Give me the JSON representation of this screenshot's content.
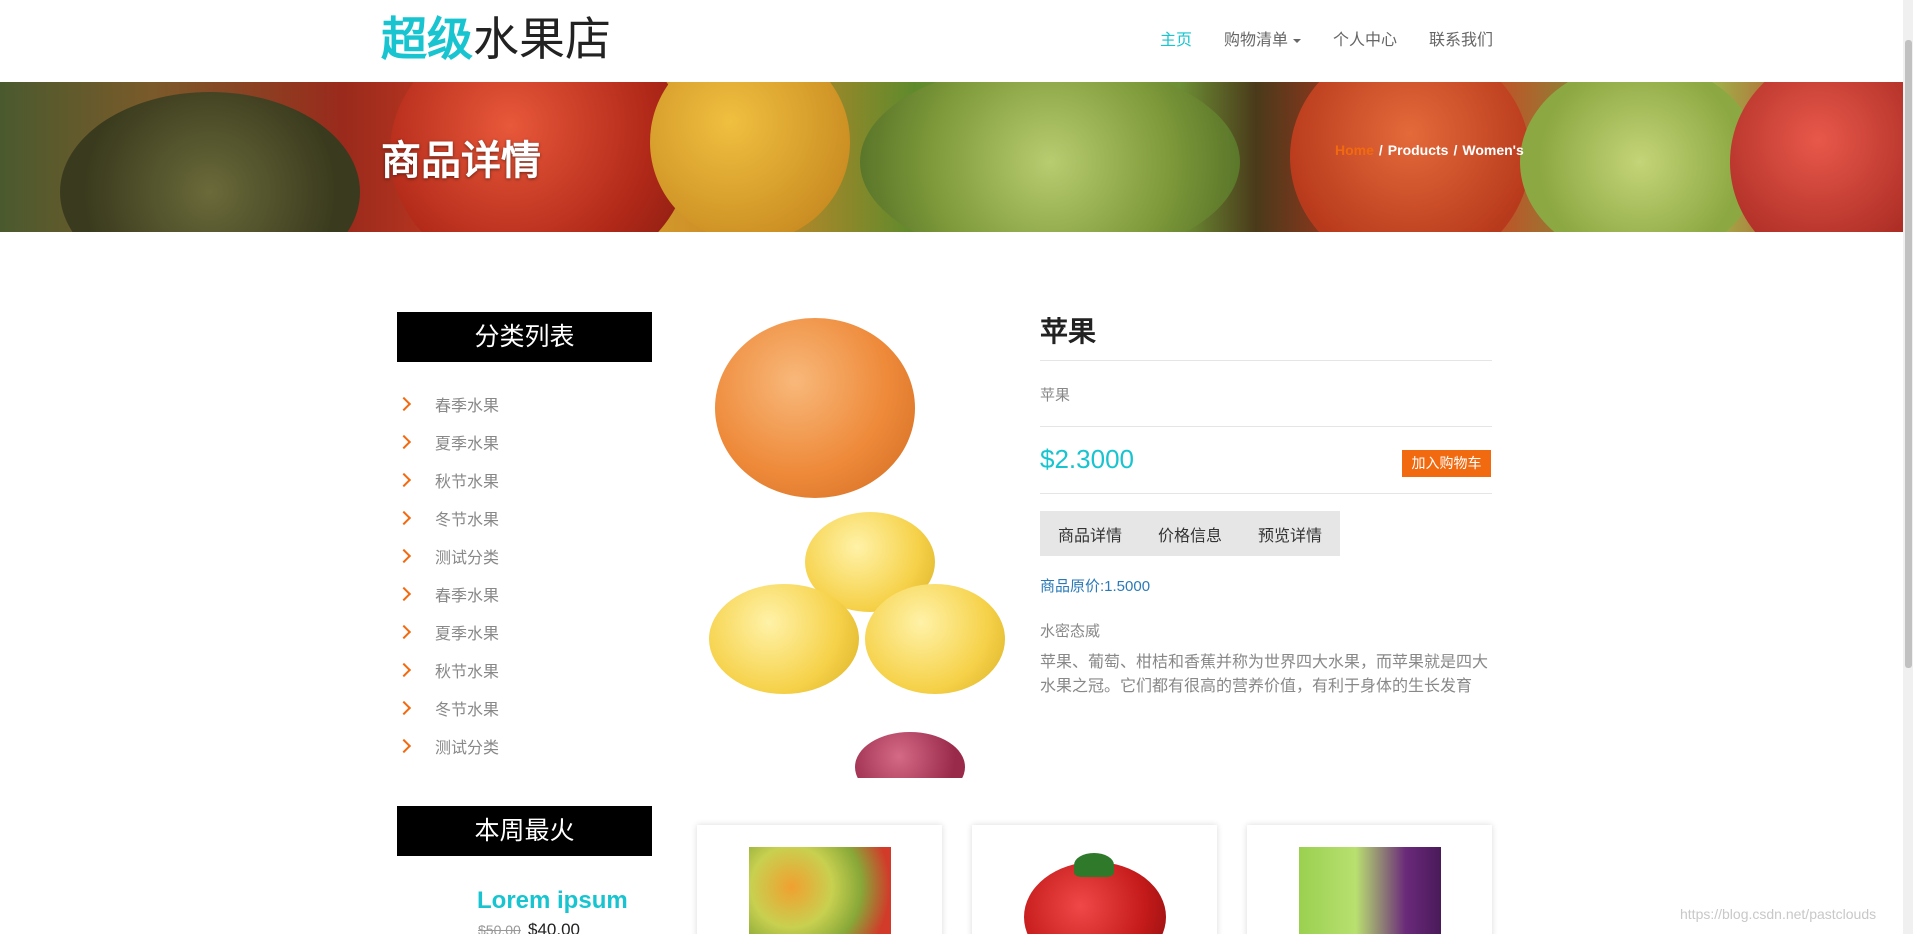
{
  "header": {
    "logo_part1": "超级",
    "logo_part2": "水果店",
    "nav": {
      "home": "主页",
      "shopping_list": "购物清单",
      "personal_center": "个人中心",
      "contact_us": "联系我们"
    }
  },
  "banner": {
    "title": "商品详情",
    "breadcrumb": [
      "Home",
      "Products",
      "Women's"
    ]
  },
  "sidebar": {
    "category_heading": "分类列表",
    "categories": [
      "春季水果",
      "夏季水果",
      "秋节水果",
      "冬节水果",
      "测试分类",
      "春季水果",
      "夏季水果",
      "秋节水果",
      "冬节水果",
      "测试分类"
    ],
    "hot_heading": "本周最火",
    "hot_item": {
      "title": "Lorem ipsum",
      "old_price": "$50.00",
      "new_price": "$40.00"
    }
  },
  "product": {
    "name": "苹果",
    "subtitle": "苹果",
    "price": "$2.3000",
    "add_to_cart": "加入购物车",
    "tabs": [
      "商品详情",
      "价格信息",
      "预览详情"
    ],
    "original_price": "商品原价:1.5000",
    "label": "水密态威",
    "description": "苹果、葡萄、柑桔和香蕉并称为世界四大水果，而苹果就是四大水果之冠。它们都有很高的营养价值，有利于身体的生长发育"
  },
  "watermark": "https://blog.csdn.net/pastclouds"
}
